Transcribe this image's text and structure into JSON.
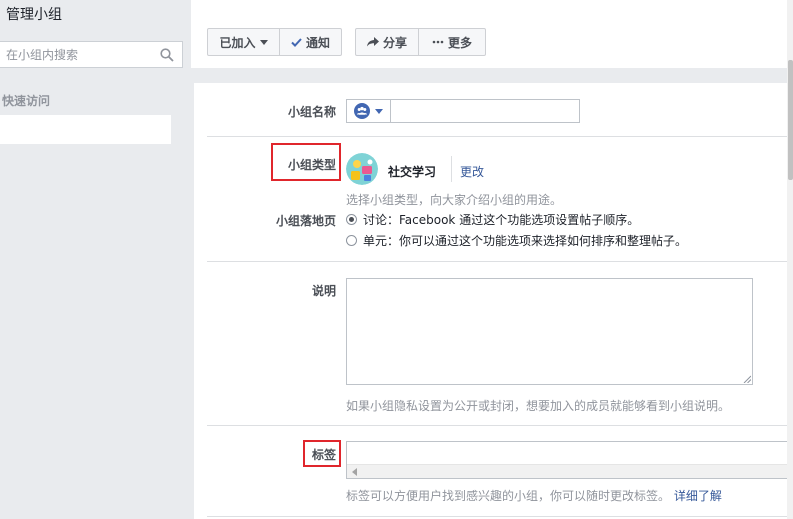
{
  "sidebar": {
    "title": "管理小组",
    "search_placeholder": "在小组内搜索",
    "quick_access": "快速访问"
  },
  "toolbar": {
    "joined_label": "已加入",
    "notify_label": "通知",
    "share_label": "分享",
    "more_label": "更多"
  },
  "form": {
    "name": {
      "label": "小组名称",
      "value": ""
    },
    "type": {
      "label": "小组类型",
      "value": "社交学习",
      "change_link": "更改",
      "help": "选择小组类型，向大家介绍小组的用途。"
    },
    "landing": {
      "label": "小组落地页",
      "options": [
        {
          "label": "讨论：Facebook 通过这个功能选项设置帖子顺序。",
          "selected": true
        },
        {
          "label": "单元：你可以通过这个功能选项来选择如何排序和整理帖子。",
          "selected": false
        }
      ]
    },
    "description": {
      "label": "说明",
      "value": "",
      "help": "如果小组隐私设置为公开或封闭，想要加入的成员就能够看到小组说明。"
    },
    "tags": {
      "label": "标签",
      "help": "标签可以方便用户找到感兴趣的小组，你可以随时更改标签。",
      "learn_more": "详细了解"
    }
  },
  "colors": {
    "highlight_box": "#e0262c",
    "link": "#365899",
    "background": "#e9ebee"
  }
}
